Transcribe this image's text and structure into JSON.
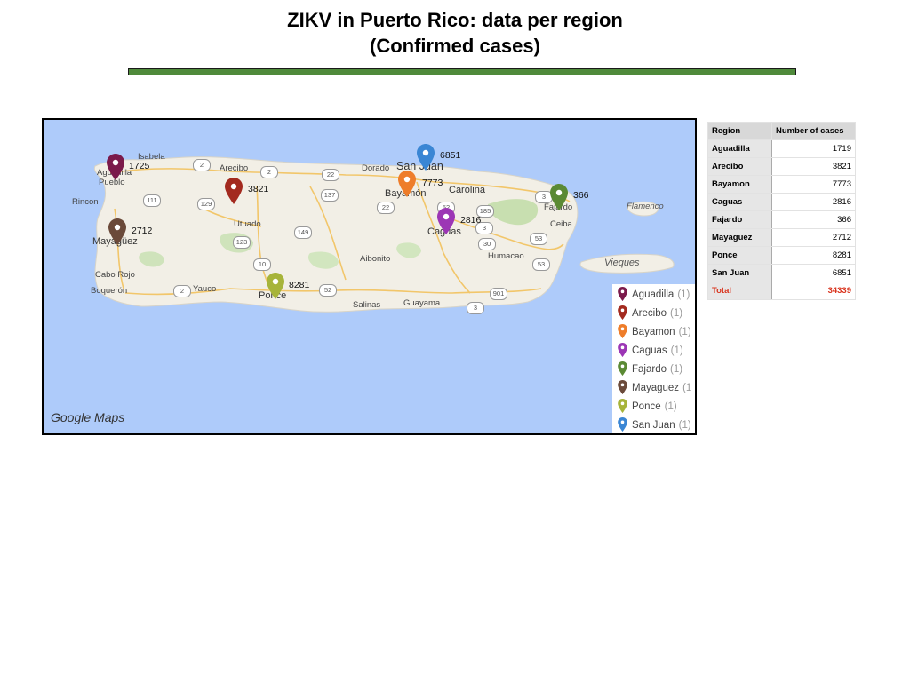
{
  "title": {
    "line1": "ZIKV in Puerto Rico: data per region",
    "line2": "(Confirmed cases)"
  },
  "map": {
    "watermark": "Google Maps",
    "place_names": {
      "isabela": "Isabela",
      "aguadilla": "Aguadilla",
      "pueblo": "Pueblo",
      "arecibo": "Arecibo",
      "dorado": "Dorado",
      "san_juan": "San Juan",
      "bayamon": "Bayamón",
      "carolina": "Carolina",
      "fajardo": "Fajardo",
      "rincon": "Rincon",
      "utuado": "Utuado",
      "caguas": "Caguas",
      "ceiba": "Ceiba",
      "flamenco": "Flamenco",
      "mayaguez": "Mayagüez",
      "aibonito": "Aibonito",
      "humacao": "Humacao",
      "vieques": "Vieques",
      "cabo_rojo": "Cabo Rojo",
      "boqueron": "Boquerón",
      "yauco": "Yauco",
      "ponce": "Ponce",
      "salinas": "Salinas",
      "guayama": "Guayama"
    },
    "road_shields": [
      "2",
      "22",
      "2",
      "137",
      "111",
      "129",
      "22",
      "52",
      "185",
      "3",
      "3",
      "149",
      "123",
      "30",
      "53",
      "10",
      "53",
      "2",
      "52",
      "901",
      "3",
      "66"
    ],
    "markers": [
      {
        "region": "Aguadilla",
        "value": "1725",
        "color": "#7b1a4b"
      },
      {
        "region": "Arecibo",
        "value": "3821",
        "color": "#a32a1f"
      },
      {
        "region": "Bayamon",
        "value": "7773",
        "color": "#ee7d2a"
      },
      {
        "region": "Caguas",
        "value": "2816",
        "color": "#9c36b5"
      },
      {
        "region": "Fajardo",
        "value": "366",
        "color": "#5b8a34"
      },
      {
        "region": "Mayaguez",
        "value": "2712",
        "color": "#6b4a3a"
      },
      {
        "region": "Ponce",
        "value": "8281",
        "color": "#a7b43a"
      },
      {
        "region": "San Juan",
        "value": "6851",
        "color": "#3a86d4"
      }
    ],
    "legend": [
      {
        "label": "Aguadilla",
        "count": "(1)"
      },
      {
        "label": "Arecibo",
        "count": "(1)"
      },
      {
        "label": "Bayamon",
        "count": "(1)"
      },
      {
        "label": "Caguas",
        "count": "(1)"
      },
      {
        "label": "Fajardo",
        "count": "(1)"
      },
      {
        "label": "Mayaguez",
        "count": "(1"
      },
      {
        "label": "Ponce",
        "count": "(1)"
      },
      {
        "label": "San Juan",
        "count": "(1)"
      }
    ]
  },
  "table": {
    "headers": [
      "Region",
      "Number of cases"
    ],
    "rows": [
      {
        "region": "Aguadilla",
        "cases": "1719"
      },
      {
        "region": "Arecibo",
        "cases": "3821"
      },
      {
        "region": "Bayamon",
        "cases": "7773"
      },
      {
        "region": "Caguas",
        "cases": "2816"
      },
      {
        "region": "Fajardo",
        "cases": "366"
      },
      {
        "region": "Mayaguez",
        "cases": "2712"
      },
      {
        "region": "Ponce",
        "cases": "8281"
      },
      {
        "region": "San Juan",
        "cases": "6851"
      }
    ],
    "total": {
      "label": "Total",
      "cases": "34339"
    }
  }
}
